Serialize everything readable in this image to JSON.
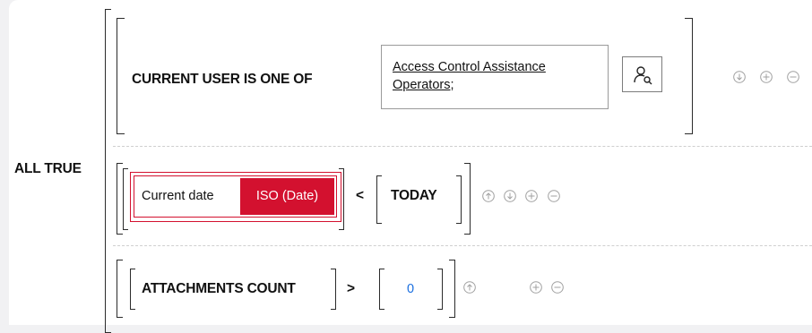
{
  "all_true_label": "ALL TRUE",
  "condition1": {
    "label": "CURRENT USER IS ONE OF",
    "value_link": "Access Control Assistance Operators;",
    "picker_icon": "user-search-icon",
    "actions": [
      "move-down-icon",
      "add-icon",
      "remove-icon"
    ]
  },
  "condition2": {
    "field_label": "Current date",
    "format_badge": "ISO (Date)",
    "operator": "<",
    "value": "TODAY",
    "actions": [
      "move-up-icon",
      "move-down-icon",
      "add-icon",
      "remove-icon"
    ]
  },
  "condition3": {
    "field_label": "ATTACHMENTS COUNT",
    "operator": ">",
    "value": "0",
    "actions": [
      "move-up-icon",
      "add-icon",
      "remove-icon"
    ]
  },
  "colors": {
    "accent_red": "#d3112f",
    "value_blue": "#1a6fe0",
    "icon_gray": "#a0a0a0"
  }
}
